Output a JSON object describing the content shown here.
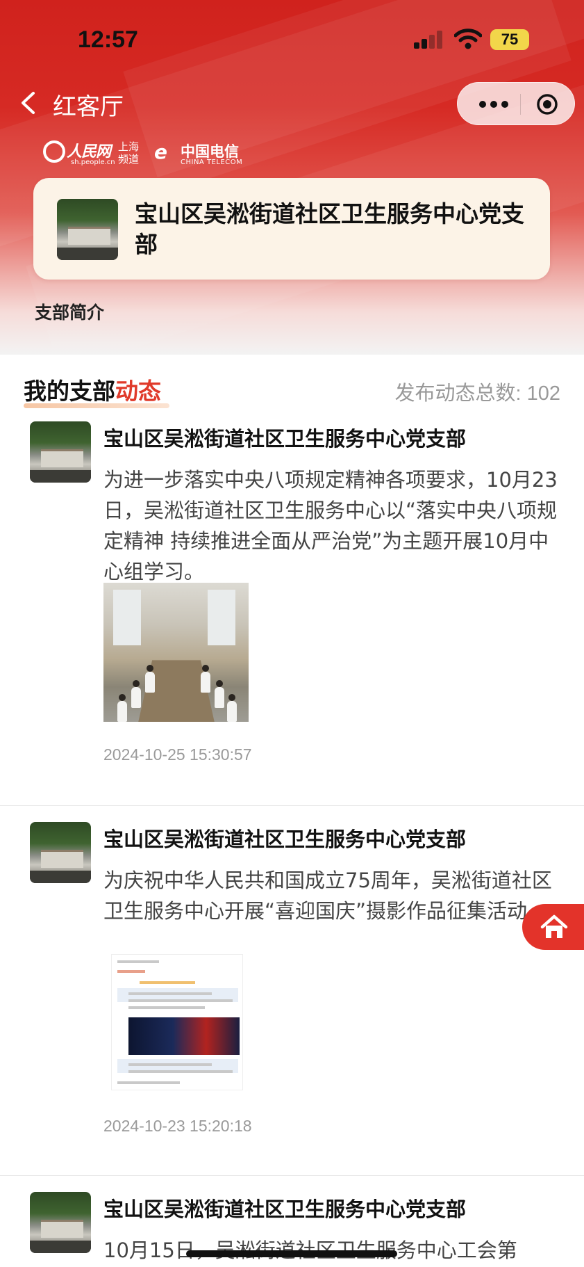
{
  "status_bar": {
    "time": "12:57",
    "battery": "75"
  },
  "nav": {
    "title": "红客厅"
  },
  "logos": {
    "people_name": "人民网",
    "people_domain": "sh.people.cn",
    "people_channel": "上海 频道",
    "telecom_mark": "e",
    "telecom_name": "中国电信",
    "telecom_en": "CHINA TELECOM"
  },
  "org": {
    "name": "宝山区吴淞街道社区卫生服务中心党支部"
  },
  "tabs": {
    "intro": "支部简介"
  },
  "feed": {
    "title_prefix": "我的支部",
    "title_accent": "动态",
    "post_count": "发布动态总数: 102"
  },
  "posts": [
    {
      "author": "宝山区吴淞街道社区卫生服务中心党支部",
      "text": "为进一步落实中央八项规定精神各项要求，10月23日，吴淞街道社区卫生服务中心以“落实中央八项规定精神  持续推进全面从严治党”为主题开展10月中心组学习。",
      "time": "2024-10-25 15:30:57"
    },
    {
      "author": "宝山区吴淞街道社区卫生服务中心党支部",
      "text": "为庆祝中华人民共和国成立75周年，吴淞街道社区卫生服务中心开展“喜迎国庆”摄影作品征集活动。",
      "time": "2024-10-23 15:20:18"
    },
    {
      "author": "宝山区吴淞街道社区卫生服务中心党支部",
      "text": "10月15日，吴淞街道社区卫生服务中心工会第"
    }
  ],
  "colors": {
    "brand_red": "#d0221d",
    "accent": "#e03a2a",
    "card_bg": "#fcf3e7"
  }
}
